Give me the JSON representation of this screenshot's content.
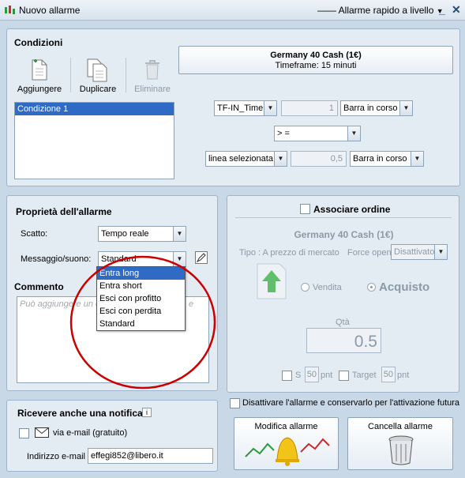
{
  "window": {
    "title": "Nuovo allarme",
    "mode": "Allarme rapido a livello",
    "minimize": "_",
    "close": "✕"
  },
  "conditions": {
    "header": "Condizioni",
    "toolbar": {
      "add": "Aggiungere",
      "duplicate": "Duplicare",
      "delete": "Eliminare"
    },
    "list": [
      "Condizione 1"
    ],
    "instrument": {
      "name": "Germany 40 Cash (1€)",
      "timeframe": "Timeframe: 15 minuti"
    },
    "row1": {
      "indicator": "TF-IN_Timer",
      "value": "1",
      "bar": "Barra in corso"
    },
    "operator": "> =",
    "row3": {
      "indicator": "linea selezionata",
      "value": "0,5",
      "bar": "Barra in corso"
    }
  },
  "properties": {
    "header": "Proprietà dell'allarme",
    "trigger_label": "Scatto:",
    "trigger_value": "Tempo reale",
    "message_label": "Messaggio/suono:",
    "message_value": "Standard",
    "message_options": [
      "Entra long",
      "Entra short",
      "Esci con profitto",
      "Esci con perdita",
      "Standard"
    ],
    "comment_label": "Commento",
    "comment_placeholder": "Può aggiungere un c",
    "comment_placeholder_tail": "e"
  },
  "order": {
    "header": "Associare ordine",
    "instrument": "Germany 40 Cash (1€)",
    "type_label": "Tipo : A prezzo di mercato",
    "force_label": "Force open",
    "force_value": "Disattivato",
    "sell": "Vendita",
    "buy": "Acquisto",
    "qty_label": "Qtà",
    "qty_value": "0.5",
    "stop_label": "S",
    "stop_value": "50",
    "stop_unit": "pnt",
    "target_label": "Target",
    "target_value": "50",
    "target_unit": "pnt"
  },
  "disable_label": "Disattivare l'allarme e conservarlo per l'attivazione futura",
  "notify": {
    "header": "Ricevere anche una notifica",
    "info": "i",
    "email_option": "via e-mail (gratuito)",
    "email_label": "Indirizzo e-mail",
    "email_value": "effegi852@libero.it"
  },
  "actions": {
    "modify": "Modifica allarme",
    "cancel": "Cancella allarme"
  },
  "colors": {
    "accent": "#2f6bc5",
    "annotation": "#cc0000",
    "panel": "#e4ecf3"
  }
}
